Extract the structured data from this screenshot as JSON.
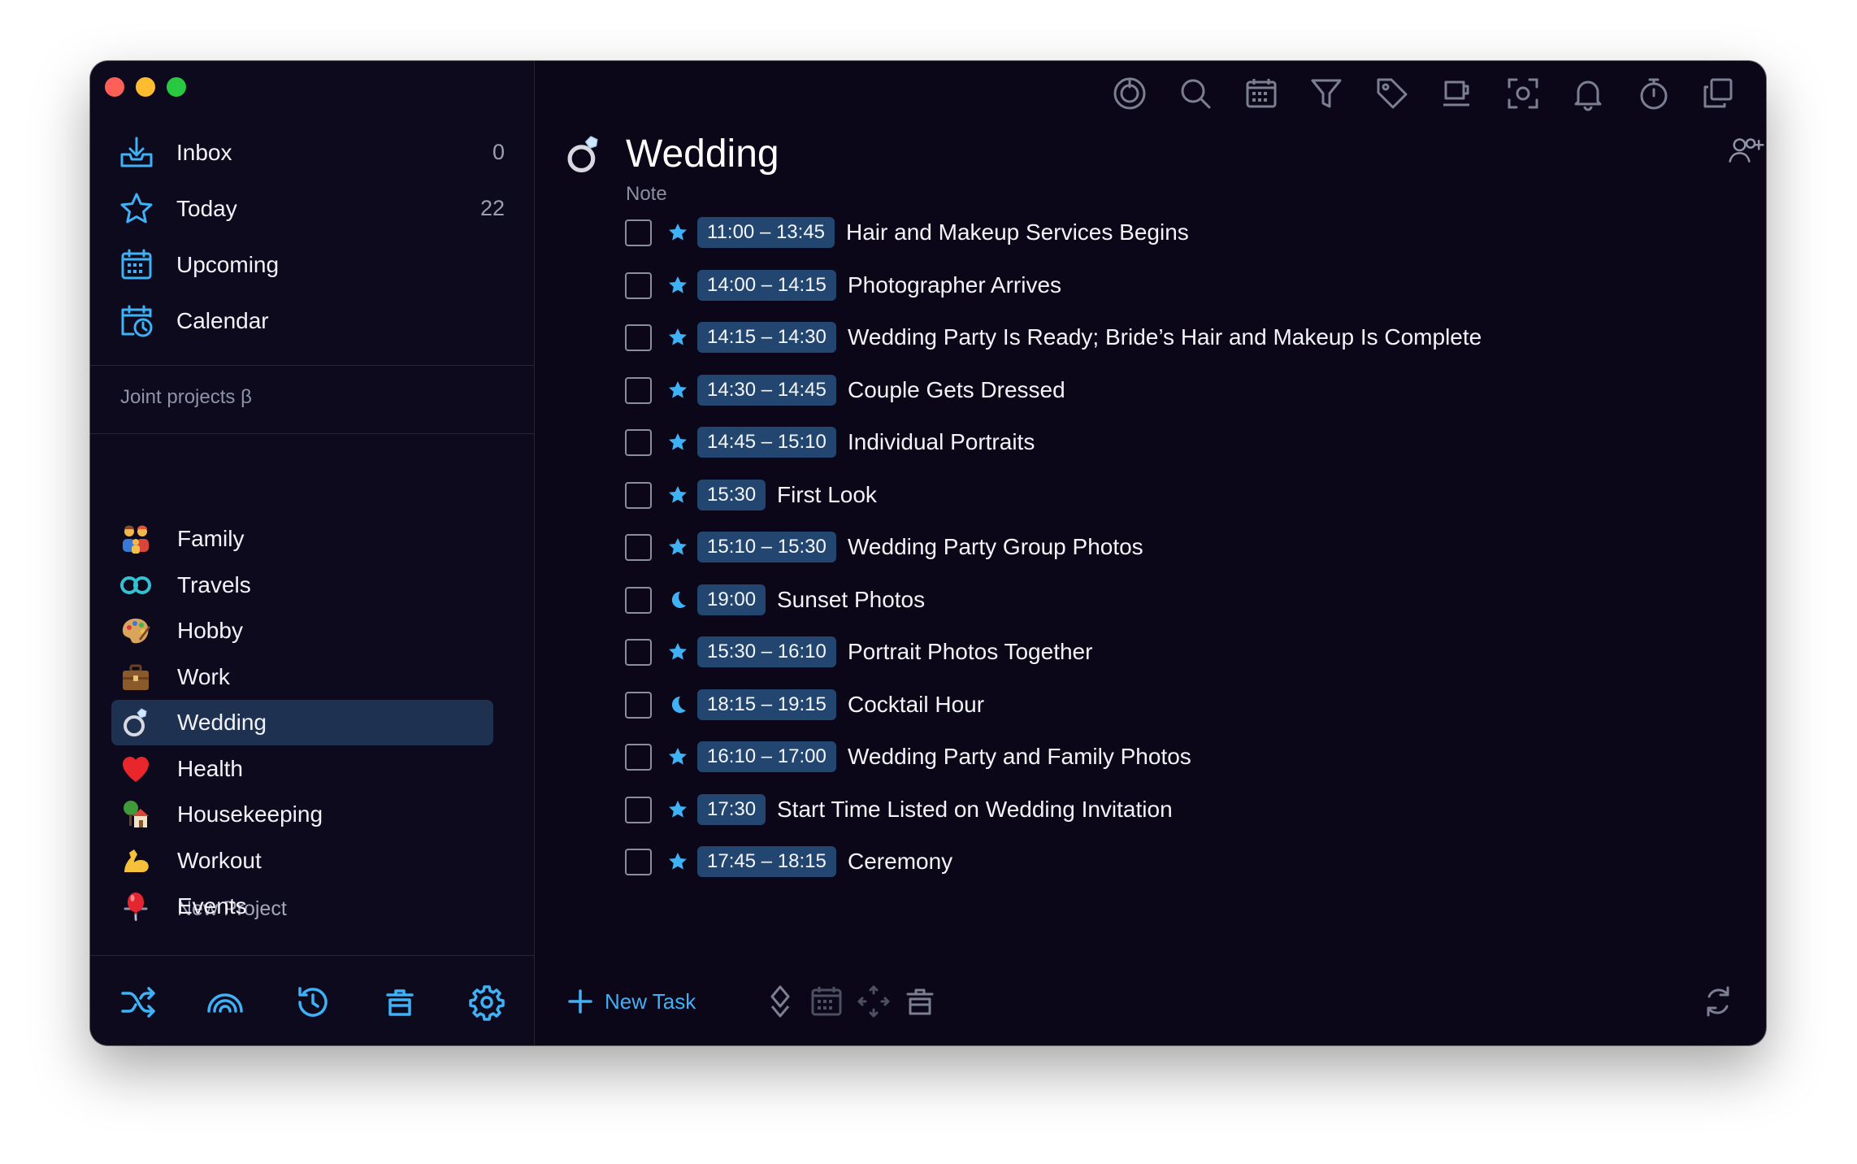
{
  "colors": {
    "accent": "#3fb1f5",
    "window_bg": "#0b0618",
    "time_badge": "#234670",
    "active_project": "#1e3150"
  },
  "sidebar": {
    "nav": [
      {
        "label": "Inbox",
        "count": "0",
        "icon": "inbox-icon"
      },
      {
        "label": "Today",
        "count": "22",
        "icon": "star-icon"
      },
      {
        "label": "Upcoming",
        "count": "",
        "icon": "upcoming-calendar-icon"
      },
      {
        "label": "Calendar",
        "count": "",
        "icon": "calendar-clock-icon"
      }
    ],
    "joint_projects": "Joint projects β",
    "projects": [
      {
        "label": "Family",
        "icon": "family-emoji-icon"
      },
      {
        "label": "Travels",
        "icon": "travel-infinity-icon"
      },
      {
        "label": "Hobby",
        "icon": "palette-emoji-icon"
      },
      {
        "label": "Work",
        "icon": "briefcase-emoji-icon"
      },
      {
        "label": "Wedding",
        "icon": "ring-emoji-icon",
        "active": true
      },
      {
        "label": "Health",
        "icon": "heart-emoji-icon"
      },
      {
        "label": "Housekeeping",
        "icon": "house-emoji-icon"
      },
      {
        "label": "Workout",
        "icon": "flexed-biceps-emoji-icon"
      },
      {
        "label": "Events",
        "icon": "balloon-emoji-icon"
      }
    ],
    "new_project": "New Project",
    "bottom_icons": [
      "shuffle-icon",
      "rainbow-icon",
      "history-icon",
      "trash-icon",
      "settings-gear-icon"
    ]
  },
  "main": {
    "title": "Wedding",
    "note": "Note",
    "toolbar_icons": [
      "focus-timer-icon",
      "search-icon",
      "calendar-icon",
      "filter-icon",
      "tag-icon",
      "coffee-icon",
      "focus-icon",
      "bell-icon",
      "stopwatch-icon",
      "copy-windows-icon"
    ],
    "tasks": [
      {
        "time": "11:00 – 13:45",
        "name": "Hair and Makeup Services Begins",
        "icon": "star"
      },
      {
        "time": "14:00 – 14:15",
        "name": "Photographer Arrives",
        "icon": "star"
      },
      {
        "time": "14:15 – 14:30",
        "name": "Wedding Party Is Ready; Bride’s Hair and Makeup Is Complete",
        "icon": "star"
      },
      {
        "time": "14:30 – 14:45",
        "name": "Couple Gets Dressed",
        "icon": "star"
      },
      {
        "time": "14:45 – 15:10",
        "name": "Individual Portraits",
        "icon": "star"
      },
      {
        "time": "15:30",
        "name": "First Look",
        "icon": "star"
      },
      {
        "time": "15:10 – 15:30",
        "name": "Wedding Party Group Photos",
        "icon": "star"
      },
      {
        "time": "19:00",
        "name": "Sunset Photos",
        "icon": "moon"
      },
      {
        "time": "15:30 – 16:10",
        "name": "Portrait Photos Together",
        "icon": "star"
      },
      {
        "time": "18:15 – 19:15",
        "name": "Cocktail Hour",
        "icon": "moon"
      },
      {
        "time": "16:10 – 17:00",
        "name": "Wedding Party and Family Photos",
        "icon": "star"
      },
      {
        "time": "17:30",
        "name": "Start Time Listed on Wedding Invitation",
        "icon": "star"
      },
      {
        "time": "17:45 – 18:15",
        "name": "Ceremony",
        "icon": "star"
      }
    ],
    "new_task": "New Task"
  }
}
